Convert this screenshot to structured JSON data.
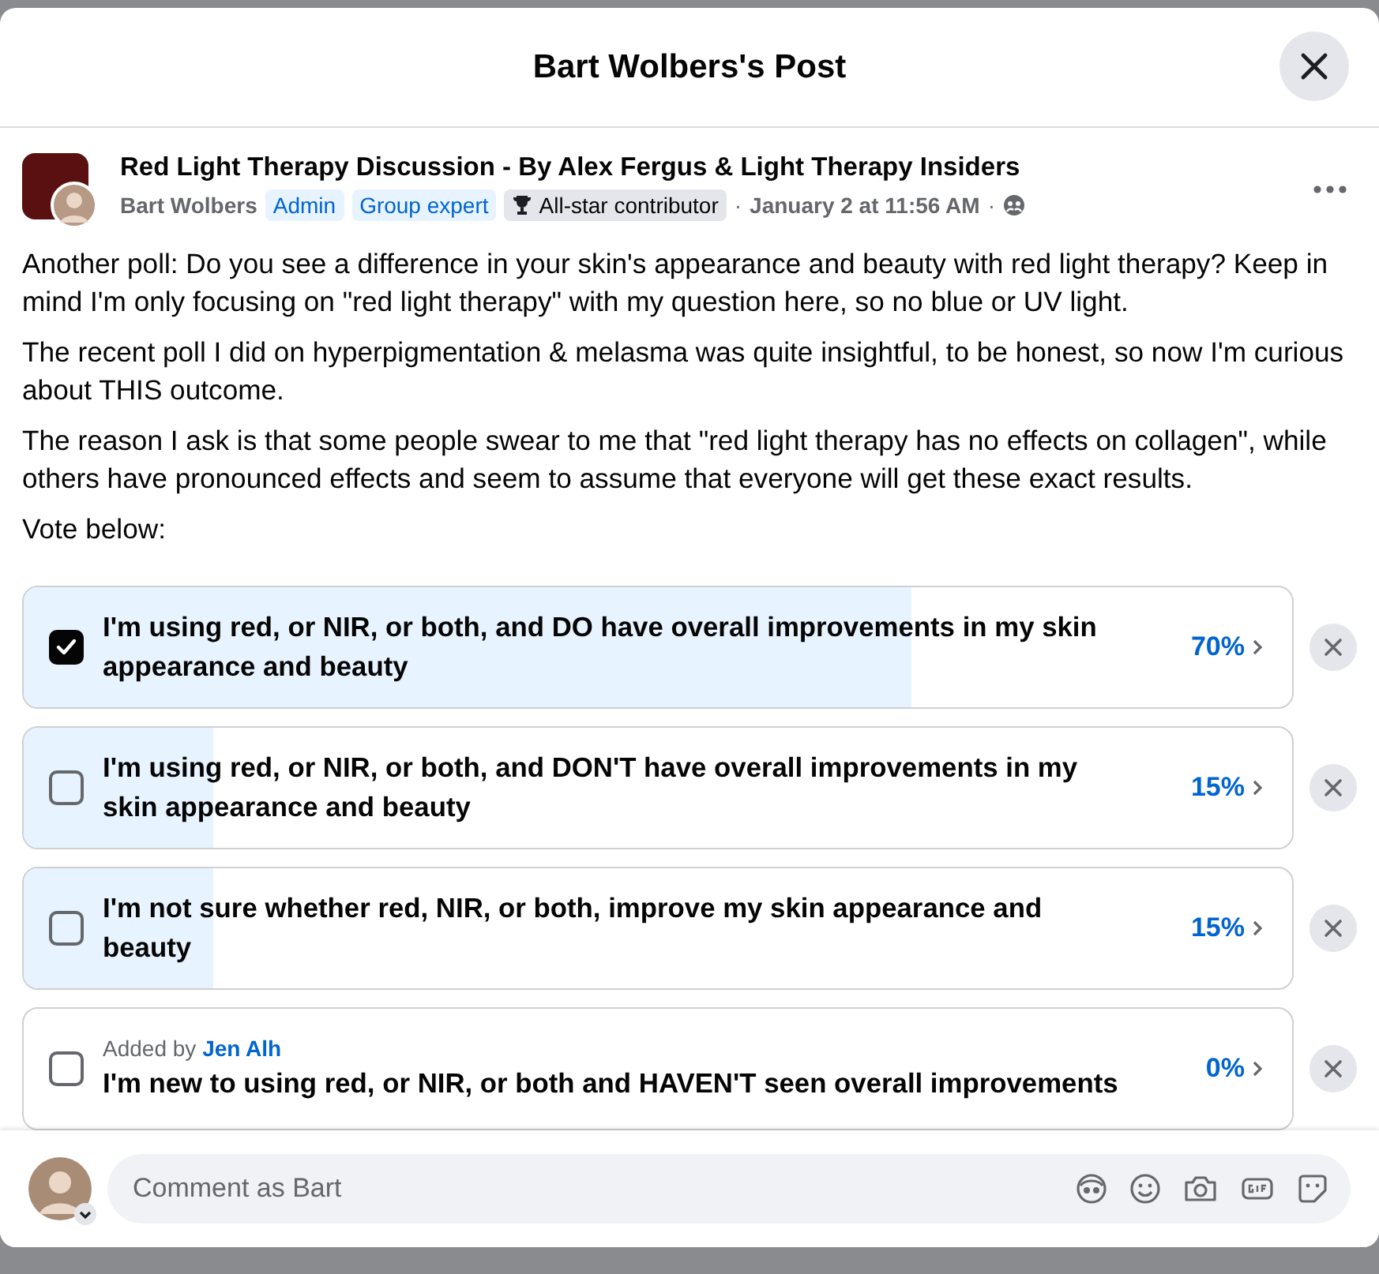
{
  "dialog": {
    "title": "Bart Wolbers's Post"
  },
  "post": {
    "group": "Red Light Therapy Discussion - By Alex Fergus & Light Therapy Insiders",
    "author": "Bart Wolbers",
    "badges": [
      {
        "label": "Admin",
        "kind": "role"
      },
      {
        "label": "Group expert",
        "kind": "role"
      },
      {
        "label": "All-star contributor",
        "kind": "award"
      }
    ],
    "time": "January 2 at 11:56 AM",
    "separator": "·",
    "paragraphs": [
      "Another poll: Do you see a difference in your skin's appearance and beauty with red light therapy? Keep in mind I'm only focusing on \"red light therapy\" with my question here, so no blue or UV light.",
      "The recent poll I did on hyperpigmentation & melasma was quite insightful, to be honest, so now I'm curious about THIS outcome.",
      "The reason I ask is that some people swear to me that \"red light therapy has no effects on collagen\", while others have pronounced effects and seem to assume that everyone will get these exact results.",
      "Vote below:"
    ]
  },
  "poll": {
    "options": [
      {
        "text": "I'm using red, or NIR, or both, and DO have overall improvements in my skin appearance and beauty",
        "percent": "70%",
        "level": 0.7,
        "checked": true
      },
      {
        "text": "I'm using red, or NIR, or both, and DON'T have overall improvements in my skin appearance and beauty",
        "percent": "15%",
        "level": 0.15,
        "checked": false
      },
      {
        "text": "I'm not sure whether red, NIR, or both, improve my skin appearance and beauty",
        "percent": "15%",
        "level": 0.15,
        "checked": false
      },
      {
        "added_by_label": "Added by",
        "added_by": "Jen Alh",
        "text": "I'm new to using red, or NIR, or both and HAVEN'T seen overall improvements",
        "percent": "0%",
        "level": 0,
        "checked": false
      }
    ]
  },
  "comment": {
    "placeholder": "Comment as Bart"
  }
}
